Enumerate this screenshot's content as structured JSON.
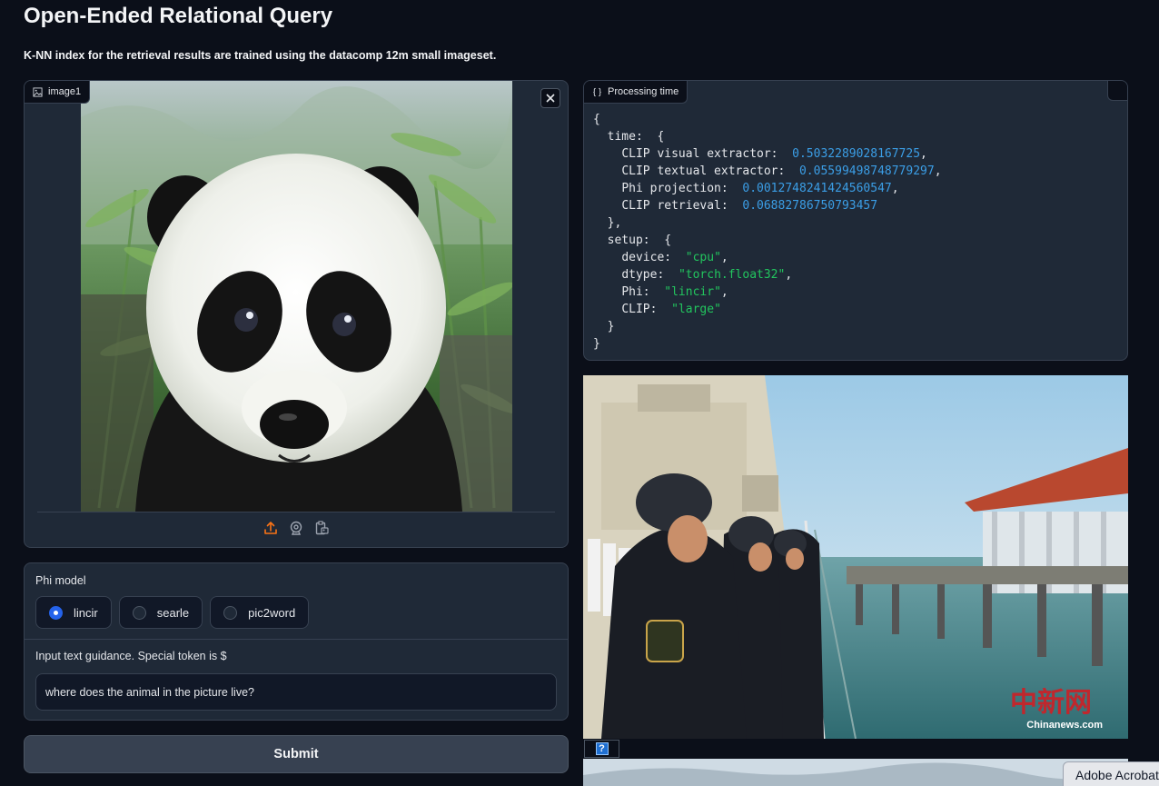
{
  "page": {
    "title": "Open-Ended Relational Query",
    "description": "K-NN index for the retrieval results are trained using the datacomp 12m small imageset."
  },
  "image_input": {
    "label": "image1",
    "image_alt": "panda",
    "source_icons": [
      "upload-icon",
      "webcam-icon",
      "clipboard-icon"
    ]
  },
  "phi_model": {
    "label": "Phi model",
    "options": [
      "lincir",
      "searle",
      "pic2word"
    ],
    "selected": "lincir"
  },
  "text_guidance": {
    "label": "Input text guidance. Special token is $",
    "value": "where does the animal in the picture live?"
  },
  "submit": {
    "label": "Submit"
  },
  "processing": {
    "label": "Processing time",
    "json": {
      "open": "{",
      "close": "}",
      "time_key": "time:",
      "setup_key": "setup:",
      "clip_visual_key": "CLIP visual extractor:",
      "clip_visual_val": "0.5032289028167725",
      "clip_textual_key": "CLIP textual extractor:",
      "clip_textual_val": "0.05599498748779297",
      "phi_proj_key": "Phi projection:",
      "phi_proj_val": "0.0012748241424560547",
      "clip_retrieval_key": "CLIP retrieval:",
      "clip_retrieval_val": "0.06882786750793457",
      "device_key": "device:",
      "device_val": "\"cpu\"",
      "dtype_key": "dtype:",
      "dtype_val": "\"torch.float32\"",
      "phi_key": "Phi:",
      "phi_val": "\"lincir\"",
      "clip_key": "CLIP:",
      "clip_val": "\"large\""
    }
  },
  "gallery": {
    "result_image_alt": "navy personnel on ship deck",
    "watermark_cn": "中新网",
    "watermark_en": "Chinanews.com"
  },
  "taskbar": {
    "acrobat_label": "Adobe Acrobat"
  }
}
